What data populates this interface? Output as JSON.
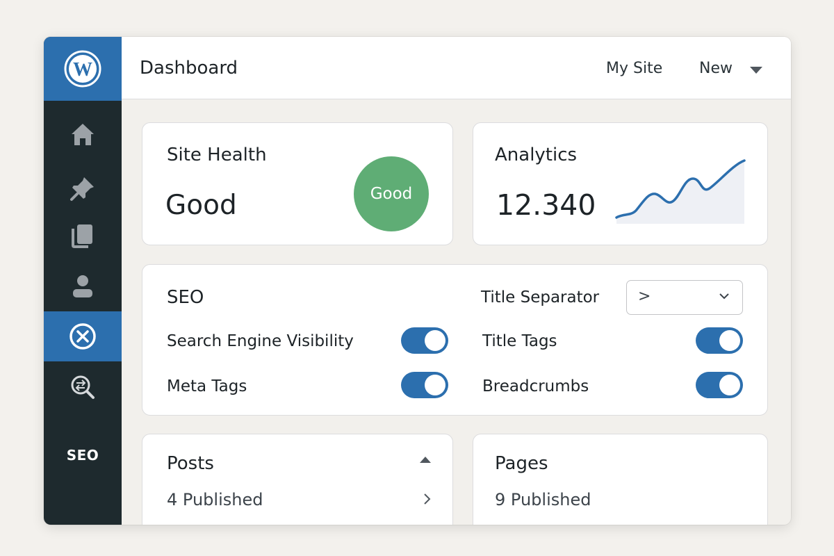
{
  "app": {
    "logo_icon": "wordpress-logo",
    "accent_color": "#2c6fae",
    "sidebar_bg": "#1e2a2e"
  },
  "sidebar": {
    "items": [
      {
        "icon": "home-icon",
        "active": false
      },
      {
        "icon": "pin-icon",
        "active": false
      },
      {
        "icon": "pages-icon",
        "active": false
      },
      {
        "icon": "user-icon",
        "active": false
      },
      {
        "icon": "seo-circle-icon",
        "active": true
      },
      {
        "icon": "search-icon",
        "active": false
      }
    ],
    "label": "SEO"
  },
  "header": {
    "title": "Dashboard",
    "my_site": "My Site",
    "new_label": "New"
  },
  "site_health": {
    "title": "Site Health",
    "value": "Good",
    "badge": "Good",
    "badge_color": "#5fad75"
  },
  "analytics": {
    "title": "Analytics",
    "value": "12.340",
    "sparkline_color": "#2c6fae"
  },
  "seo": {
    "title": "SEO",
    "title_separator_label": "Title Separator",
    "title_separator_value": ">",
    "settings": [
      {
        "label": "Search Engine Visibility",
        "enabled": true
      },
      {
        "label": "Meta Tags",
        "enabled": true
      },
      {
        "label": "Title Tags",
        "enabled": true
      },
      {
        "label": "Breadcrumbs",
        "enabled": true
      }
    ]
  },
  "posts": {
    "title": "Posts",
    "status": "4 Published"
  },
  "pages": {
    "title": "Pages",
    "status": "9 Published"
  }
}
